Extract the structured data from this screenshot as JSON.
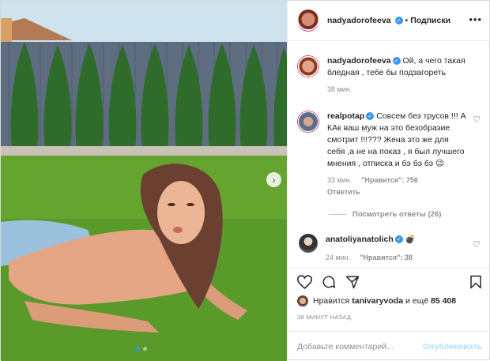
{
  "post": {
    "author": "nadyadorofeeva",
    "header_separator": "•",
    "follow_label": "Подписки",
    "more_icon": "ellipsis-icon"
  },
  "caption": {
    "username": "nadyadorofeeva",
    "text": "Ой, а чего такая бледная , тебе бы подзагореть",
    "time": "38 мин."
  },
  "comments": [
    {
      "username": "realpotap",
      "text": "Совсем без трусов !!! А КАк ваш муж на это безобразие смотрит !!!??? Жена это же для себя ,а не на показ , я был лучшего мнения , отписка и бэ бэ бэ 😉",
      "time": "33 мин.",
      "likes": "\"Нравится\": 756",
      "reply_label": "Ответить",
      "view_replies": "Посмотреть ответы (26)"
    },
    {
      "username": "anatoliyanatolich",
      "badge": "💣",
      "time": "24 мин.",
      "likes": "\"Нравится\": 38"
    }
  ],
  "actions": {
    "liked_by_prefix": "Нравится",
    "liked_by_user": "tanivaryvoda",
    "liked_by_suffix": "и ещё",
    "liked_by_count": "85 408",
    "timestamp": "38 МИНУТ НАЗАД"
  },
  "add_comment": {
    "placeholder": "Добавьте комментарий...",
    "publish_label": "Опубликовать"
  },
  "carousel": {
    "next_glyph": "›",
    "slide_count": 2,
    "active_index": 0
  },
  "colors": {
    "accent": "#3897f0",
    "publish_disabled": "#b2dffc",
    "secondary_text": "#8e8e8e"
  }
}
